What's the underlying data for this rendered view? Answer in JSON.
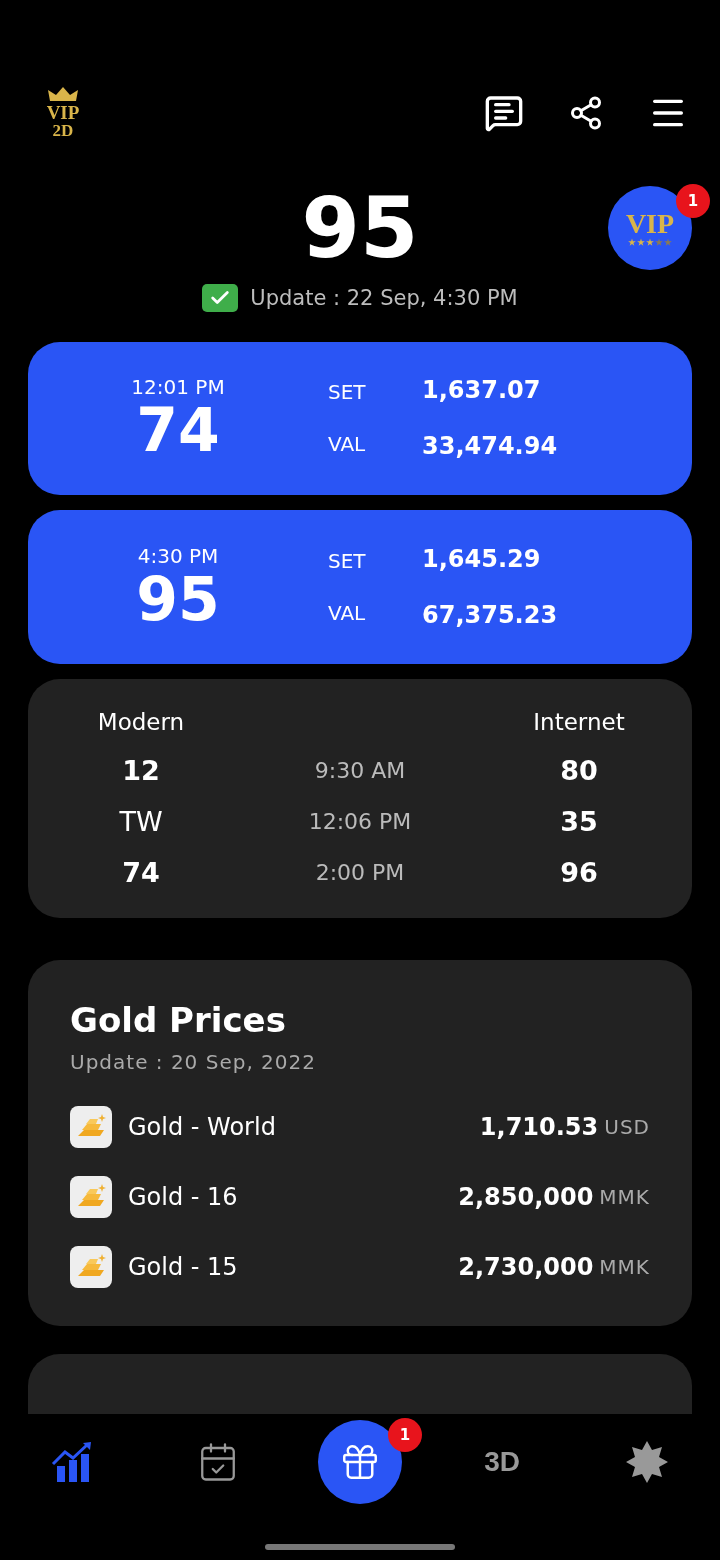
{
  "header": {
    "logo": {
      "top": "VIP",
      "bottom": "2D"
    }
  },
  "result": {
    "number": "95",
    "update": "Update : 22 Sep, 4:30 PM",
    "verified": true
  },
  "vip_button": {
    "label": "VIP",
    "badge": "1",
    "stars": 3
  },
  "sessions": [
    {
      "time": "12:01 PM",
      "number": "74",
      "set_label": "SET",
      "set": "1,637.07",
      "val_label": "VAL",
      "val": "33,474.94"
    },
    {
      "time": "4:30 PM",
      "number": "95",
      "set_label": "SET",
      "set": "1,645.29",
      "val_label": "VAL",
      "val": "67,375.23"
    }
  ],
  "modern_internet": {
    "left_header": "Modern",
    "right_header": "Internet",
    "rows": [
      {
        "modern": "12",
        "time": "9:30 AM",
        "internet": "80"
      },
      {
        "modern": "TW",
        "time": "12:06 PM",
        "internet": "35"
      },
      {
        "modern": "74",
        "time": "2:00 PM",
        "internet": "96"
      }
    ]
  },
  "gold": {
    "title": "Gold Prices",
    "update": "Update : 20 Sep, 2022",
    "items": [
      {
        "name": "Gold - World",
        "price": "1,710.53",
        "unit": "USD"
      },
      {
        "name": "Gold - 16",
        "price": "2,850,000",
        "unit": "MMK"
      },
      {
        "name": "Gold - 15",
        "price": "2,730,000",
        "unit": "MMK"
      }
    ]
  },
  "nav": [
    {
      "kind": "chart",
      "selected": true
    },
    {
      "kind": "calendar",
      "selected": false
    },
    {
      "kind": "gift",
      "badge": "1",
      "selected": false
    },
    {
      "kind": "text",
      "label": "3D",
      "selected": false
    },
    {
      "kind": "star",
      "selected": false
    }
  ]
}
